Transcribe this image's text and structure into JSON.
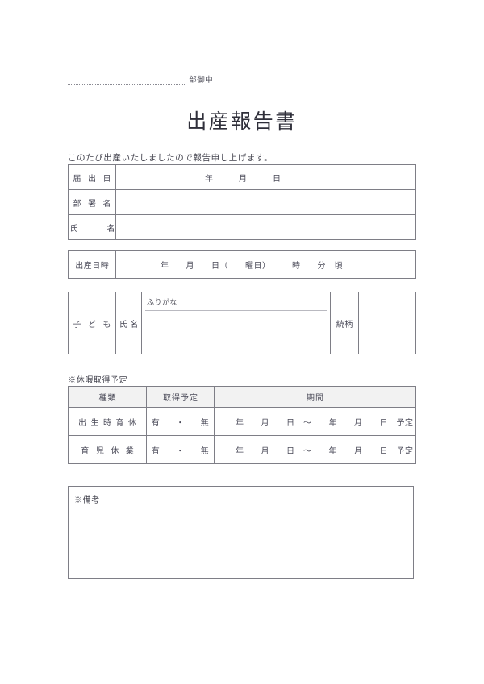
{
  "addressee": {
    "label": "部御中"
  },
  "title": "出産報告書",
  "intro": "このたび出産いたしましたので報告申し上げます。",
  "applicant_table": {
    "rows": [
      {
        "label": "届 出 日",
        "value": "年　　　月　　　日"
      },
      {
        "label": "部 署 名",
        "value": ""
      },
      {
        "label": "氏　　　名",
        "value": ""
      }
    ]
  },
  "birth_datetime": {
    "label": "出産日時",
    "value": "年　　月　　日（　　曜日）　　　時　　分　頃"
  },
  "child_table": {
    "label": "子 ど も",
    "name_label": "氏 名",
    "furigana_label": "ふりがな",
    "name_value": "",
    "relation_label": "続柄",
    "relation_value": ""
  },
  "leave_section": {
    "heading": "※休暇取得予定",
    "headers": [
      "種類",
      "取得予定",
      "期間"
    ],
    "rows": [
      {
        "type": "出 生 時 育 休",
        "choice_yes": "有",
        "choice_sep": "・",
        "choice_no": "無",
        "period": "年　　月　　日　～　　年　　月　　日　予定"
      },
      {
        "type": "育 児 休 業",
        "choice_yes": "有",
        "choice_sep": "・",
        "choice_no": "無",
        "period": "年　　月　　日　～　　年　　月　　日　予定"
      }
    ]
  },
  "remarks": {
    "label": "※備考",
    "value": ""
  },
  "colors": {
    "border": "#7e7e86",
    "header_fill": "#f2f2f2",
    "text": "#4a4a58"
  }
}
